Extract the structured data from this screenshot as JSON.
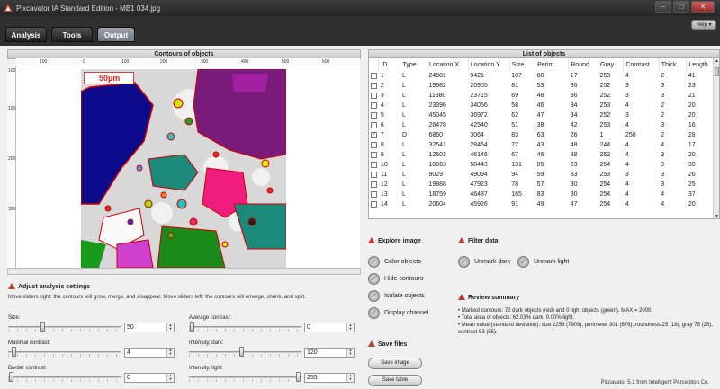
{
  "window": {
    "title": "Pixcavator IA Standard Edition - MB1 034.jpg"
  },
  "tabs": [
    {
      "label": "Analysis"
    },
    {
      "label": "Tools"
    },
    {
      "label": "Output"
    }
  ],
  "help_label": "Help",
  "contours": {
    "header": "Contours of objects",
    "ruler_x": [
      "100",
      "0",
      "100",
      "200",
      "300",
      "400",
      "500",
      "600"
    ],
    "ruler_y": [
      "100",
      "100",
      "200",
      "300"
    ],
    "scale_label": "50µm"
  },
  "settings": {
    "title": "Adjust analysis settings",
    "hint": "Move sliders right: the contours will grow, merge, and disappear. Move sliders left: the contours will emerge, shrink, and split.",
    "size": {
      "label": "Size:",
      "value": "50",
      "level": 0.3
    },
    "maxcontrast": {
      "label": "Maximal contrast:",
      "value": "4",
      "level": 0.03
    },
    "border": {
      "label": "Border contrast:",
      "value": "0",
      "level": 0.01
    },
    "avgcontrast": {
      "label": "Average contrast:",
      "value": "0",
      "level": 0.01
    },
    "dark": {
      "label": "Intensity, dark:",
      "value": "120",
      "level": 0.47
    },
    "light": {
      "label": "Intensity, light:",
      "value": "255",
      "level": 0.99
    }
  },
  "list": {
    "header": "List of objects",
    "columns": [
      "ID",
      "Type",
      "Location X",
      "Location Y",
      "Size",
      "Perim.",
      "Round.",
      "Gray",
      "Contrast",
      "Thick.",
      "Length"
    ],
    "rows": [
      {
        "checked": false,
        "cells": [
          "1",
          "L",
          "24881",
          "9421",
          "107",
          "88",
          "17",
          "253",
          "4",
          "2",
          "41"
        ]
      },
      {
        "checked": false,
        "cells": [
          "2",
          "L",
          "19982",
          "20905",
          "81",
          "53",
          "36",
          "252",
          "3",
          "3",
          "23"
        ]
      },
      {
        "checked": false,
        "cells": [
          "3",
          "L",
          "11380",
          "23715",
          "69",
          "48",
          "36",
          "252",
          "3",
          "3",
          "21"
        ]
      },
      {
        "checked": false,
        "cells": [
          "4",
          "L",
          "23396",
          "34056",
          "58",
          "46",
          "34",
          "253",
          "4",
          "2",
          "20"
        ]
      },
      {
        "checked": false,
        "cells": [
          "5",
          "L",
          "45045",
          "36972",
          "62",
          "47",
          "34",
          "252",
          "3",
          "2",
          "20"
        ]
      },
      {
        "checked": false,
        "cells": [
          "6",
          "L",
          "26478",
          "42540",
          "51",
          "38",
          "42",
          "253",
          "4",
          "3",
          "16"
        ]
      },
      {
        "checked": true,
        "cells": [
          "7",
          "D",
          "6860",
          "3064",
          "83",
          "63",
          "26",
          "1",
          "250",
          "2",
          "28"
        ]
      },
      {
        "checked": false,
        "cells": [
          "8",
          "L",
          "32541",
          "28464",
          "72",
          "43",
          "48",
          "244",
          "4",
          "4",
          "17"
        ]
      },
      {
        "checked": false,
        "cells": [
          "9",
          "L",
          "12603",
          "46146",
          "67",
          "46",
          "38",
          "252",
          "4",
          "3",
          "20"
        ]
      },
      {
        "checked": false,
        "cells": [
          "10",
          "L",
          "10063",
          "50443",
          "131",
          "85",
          "23",
          "254",
          "4",
          "3",
          "39"
        ]
      },
      {
        "checked": false,
        "cells": [
          "11",
          "L",
          "9029",
          "49094",
          "94",
          "59",
          "33",
          "253",
          "3",
          "3",
          "26"
        ]
      },
      {
        "checked": false,
        "cells": [
          "12",
          "L",
          "19988",
          "47923",
          "78",
          "57",
          "30",
          "254",
          "4",
          "3",
          "25"
        ]
      },
      {
        "checked": false,
        "cells": [
          "13",
          "L",
          "18759",
          "46487",
          "165",
          "83",
          "30",
          "254",
          "4",
          "4",
          "37"
        ]
      },
      {
        "checked": false,
        "cells": [
          "14",
          "L",
          "20604",
          "45926",
          "91",
          "49",
          "47",
          "254",
          "4",
          "4",
          "20"
        ]
      }
    ]
  },
  "explore": {
    "title": "Explore image",
    "options": [
      "Color objects",
      "Hide contours",
      "Isolate objects",
      "Display channel"
    ]
  },
  "filter": {
    "title": "Filter data",
    "options": [
      "Unmark dark",
      "Unmark light"
    ]
  },
  "review": {
    "title": "Review summary",
    "lines": [
      "• Marked contours: 72 dark objects (red) and 0 light objects (green). MAX = 2000.",
      "• Total area of objects: 62.03% dark, 0.00% light.",
      "• Mean value (standard deviation): size 2258 (7909), perimeter 301 (676), roundness 25 (18), gray 75 (25), contrast 53 (55)."
    ]
  },
  "save": {
    "title": "Save files",
    "image_label": "Save image",
    "table_label": "Save table"
  },
  "footer": "Pixcavator 5.1 from Intelligent Perception Co.",
  "colors": {
    "accent_red": "#c0392b",
    "tab_active": "#8a939c",
    "check_green": "#2a7a2a"
  }
}
